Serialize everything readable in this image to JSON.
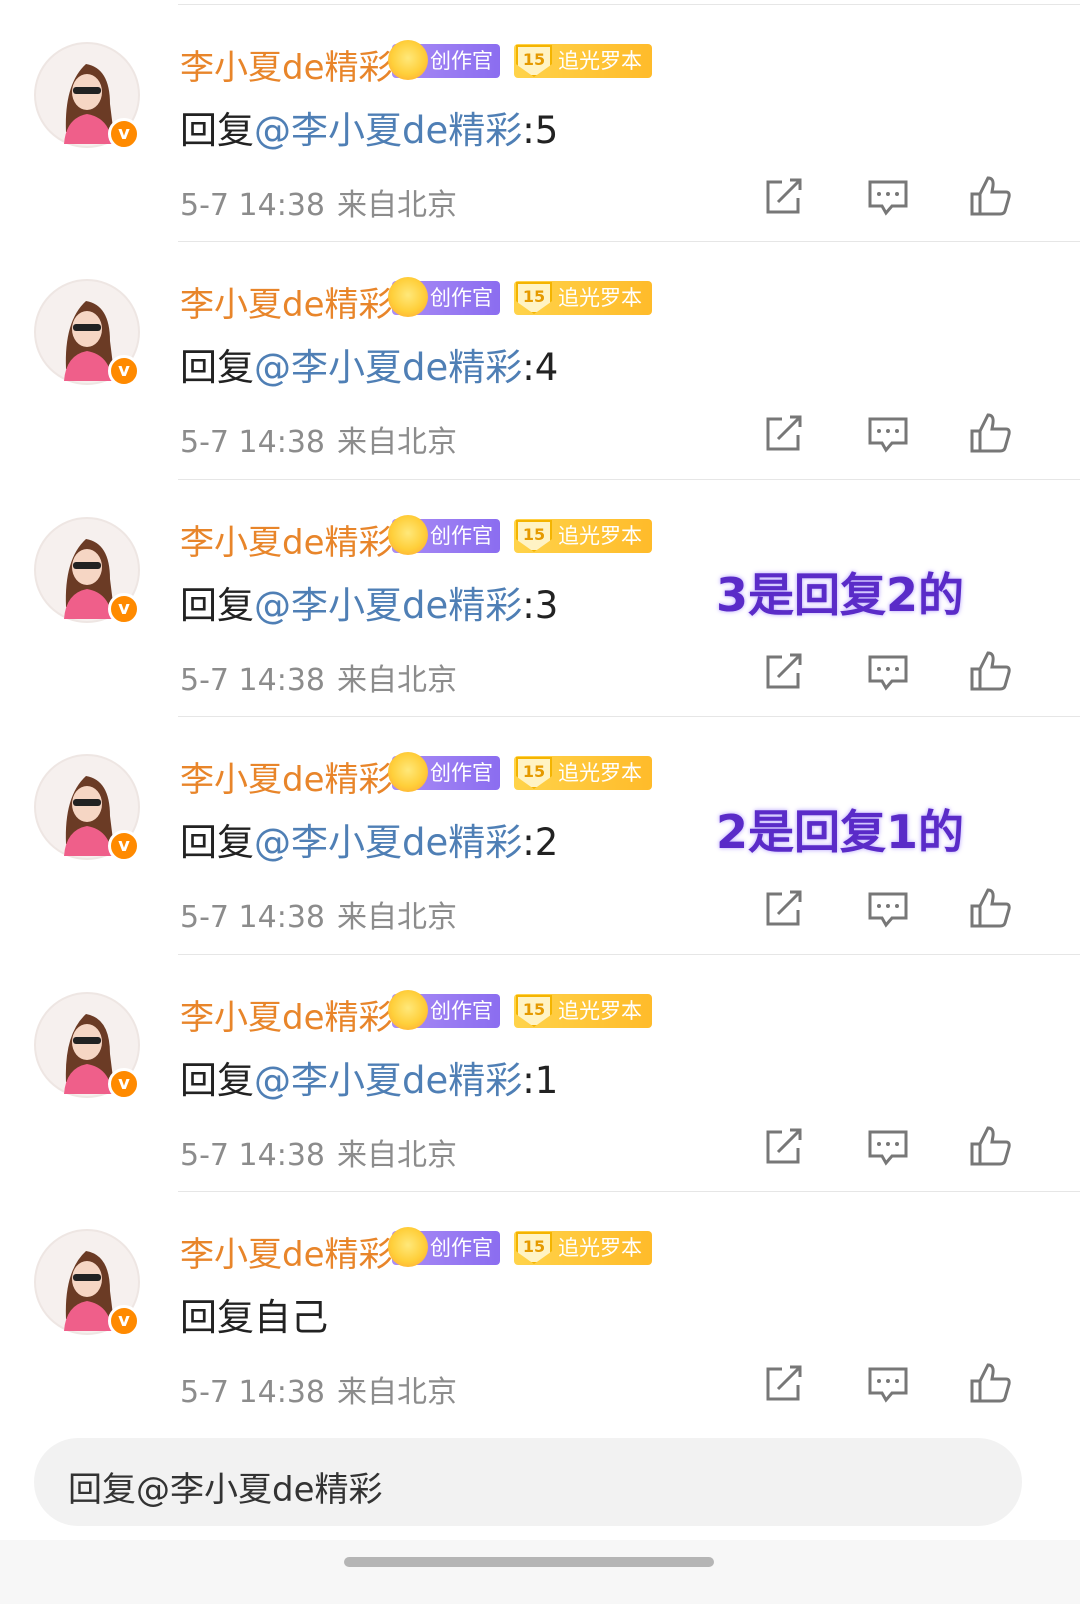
{
  "comments": [
    {
      "username": "李小夏de精彩",
      "badge_creator": "创作官",
      "badge_level": "15",
      "badge_level_label": "追光罗本",
      "content_prefix": "回复",
      "mention": "@李小夏de精彩",
      "content_suffix": ":5",
      "date": "5-7 14:38",
      "location": "来自北京"
    },
    {
      "username": "李小夏de精彩",
      "badge_creator": "创作官",
      "badge_level": "15",
      "badge_level_label": "追光罗本",
      "content_prefix": "回复",
      "mention": "@李小夏de精彩",
      "content_suffix": ":4",
      "date": "5-7 14:38",
      "location": "来自北京"
    },
    {
      "username": "李小夏de精彩",
      "badge_creator": "创作官",
      "badge_level": "15",
      "badge_level_label": "追光罗本",
      "content_prefix": "回复",
      "mention": "@李小夏de精彩",
      "content_suffix": ":3",
      "date": "5-7 14:38",
      "location": "来自北京"
    },
    {
      "username": "李小夏de精彩",
      "badge_creator": "创作官",
      "badge_level": "15",
      "badge_level_label": "追光罗本",
      "content_prefix": "回复",
      "mention": "@李小夏de精彩",
      "content_suffix": ":2",
      "date": "5-7 14:38",
      "location": "来自北京"
    },
    {
      "username": "李小夏de精彩",
      "badge_creator": "创作官",
      "badge_level": "15",
      "badge_level_label": "追光罗本",
      "content_prefix": "回复",
      "mention": "@李小夏de精彩",
      "content_suffix": ":1",
      "date": "5-7 14:38",
      "location": "来自北京"
    },
    {
      "username": "李小夏de精彩",
      "badge_creator": "创作官",
      "badge_level": "15",
      "badge_level_label": "追光罗本",
      "content_prefix": "回复自己",
      "mention": "",
      "content_suffix": "",
      "date": "5-7 14:38",
      "location": "来自北京"
    }
  ],
  "annotations": {
    "note_3": "3是回复2的",
    "note_2": "2是回复1的"
  },
  "reply_box": {
    "placeholder": "回复@李小夏de精彩"
  },
  "verified_mark": "v",
  "icons": {
    "share": "share-icon",
    "comment": "comment-icon",
    "like": "like-icon"
  },
  "colors": {
    "username": "#e8852a",
    "mention": "#4f7fb5",
    "meta": "#8c8c8c",
    "annotation": "#5a2bc8",
    "verified": "#ff8a00"
  }
}
